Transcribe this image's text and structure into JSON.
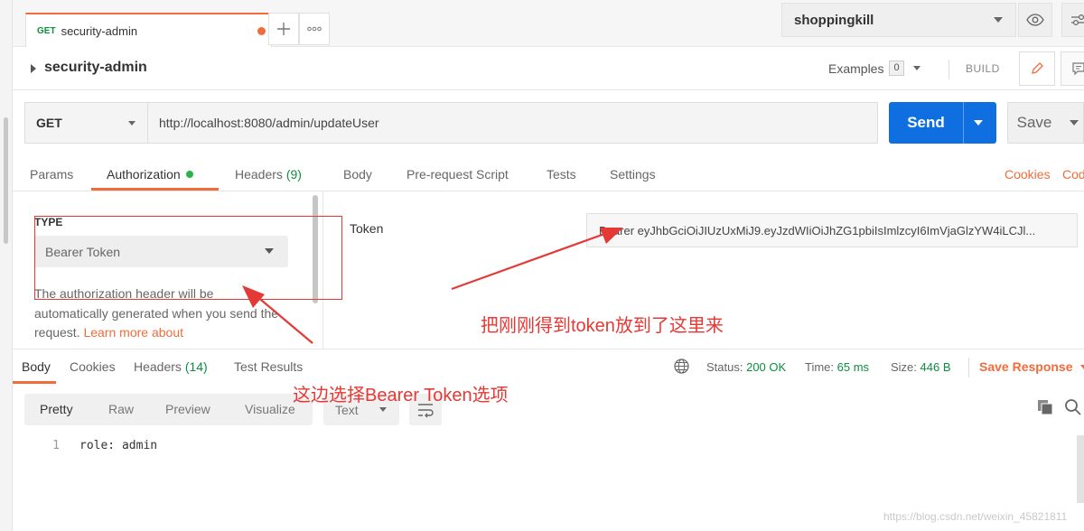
{
  "tabs": [
    {
      "method": "GET",
      "name": "security-admin",
      "unsaved": true
    }
  ],
  "environment": {
    "selected": "shoppingkill"
  },
  "request": {
    "title": "security-admin",
    "examples_label": "Examples",
    "examples_count": "0",
    "build_label": "BUILD",
    "method": "GET",
    "url": "http://localhost:8080/admin/updateUser",
    "send_label": "Send",
    "save_label": "Save"
  },
  "request_tabs": {
    "params": "Params",
    "authorization": "Authorization",
    "headers": "Headers",
    "headers_count": "(9)",
    "body": "Body",
    "prerequest": "Pre-request Script",
    "tests": "Tests",
    "settings": "Settings",
    "cookies": "Cookies",
    "code": "Cod"
  },
  "auth": {
    "type_label": "TYPE",
    "type_value": "Bearer Token",
    "description": "The authorization header will be automatically generated when you send the request. ",
    "learn_more": "Learn more about",
    "token_label": "Token",
    "token_value": "Bearer eyJhbGciOiJIUzUxMiJ9.eyJzdWIiOiJhZG1pbiIsImlzcyI6ImVjaGlzYW4iLCJl..."
  },
  "response": {
    "tabs": {
      "body": "Body",
      "cookies": "Cookies",
      "headers": "Headers",
      "headers_count": "(14)",
      "test_results": "Test Results"
    },
    "status_label": "Status:",
    "status_value": "200 OK",
    "time_label": "Time:",
    "time_value": "65 ms",
    "size_label": "Size:",
    "size_value": "446 B",
    "save_response": "Save Response",
    "formats": [
      "Pretty",
      "Raw",
      "Preview",
      "Visualize"
    ],
    "type_select": "Text",
    "lines": [
      {
        "number": "1",
        "text": "role: admin"
      }
    ]
  },
  "annotations": {
    "token_note": "把刚刚得到token放到了这里来",
    "type_note": "这边选择Bearer Token选项"
  },
  "watermark": "https://blog.csdn.net/weixin_45821811",
  "colors": {
    "accent": "#f26b3a",
    "send": "#0f6fe0",
    "success": "#0c8f3e",
    "annotation": "#e53935"
  }
}
